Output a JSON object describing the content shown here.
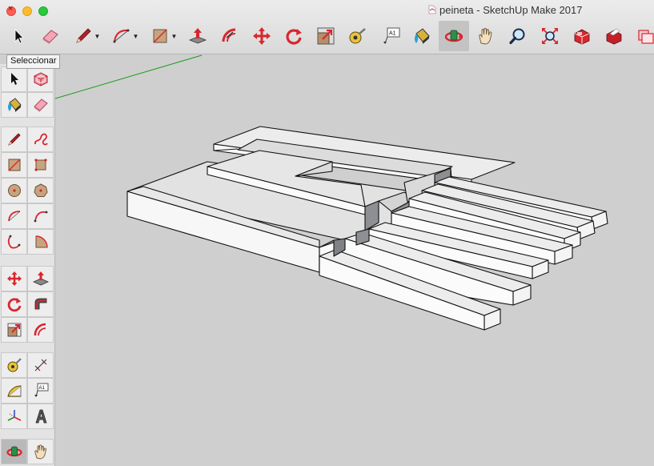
{
  "window": {
    "title": "peineta - SketchUp Make 2017"
  },
  "toolbar": {
    "items": [
      {
        "name": "select-tool",
        "icon": "arrow-cursor-icon"
      },
      {
        "name": "eraser-tool",
        "icon": "eraser-icon"
      },
      {
        "name": "line-tool",
        "icon": "pencil-icon",
        "dropdown": true
      },
      {
        "name": "arc-tool",
        "icon": "arc-icon",
        "dropdown": true
      },
      {
        "name": "rectangle-tool",
        "icon": "rectangle-icon",
        "dropdown": true
      },
      {
        "name": "push-pull-tool",
        "icon": "push-pull-icon"
      },
      {
        "name": "offset-tool",
        "icon": "offset-icon"
      },
      {
        "name": "move-tool",
        "icon": "move-arrows-icon"
      },
      {
        "name": "rotate-tool",
        "icon": "rotate-icon"
      },
      {
        "name": "scale-tool",
        "icon": "scale-icon"
      },
      {
        "name": "tape-measure-tool",
        "icon": "tape-measure-icon"
      },
      {
        "name": "text-tool",
        "icon": "text-label-icon"
      },
      {
        "name": "paint-bucket-tool",
        "icon": "paint-bucket-icon"
      },
      {
        "name": "orbit-tool",
        "icon": "orbit-icon",
        "active": true
      },
      {
        "name": "pan-tool",
        "icon": "hand-icon"
      },
      {
        "name": "zoom-tool",
        "icon": "magnifier-icon"
      },
      {
        "name": "zoom-extents-tool",
        "icon": "zoom-extents-icon"
      },
      {
        "name": "warehouse-tool",
        "icon": "3d-warehouse-icon"
      },
      {
        "name": "share-model-tool",
        "icon": "share-model-icon"
      },
      {
        "name": "extension-warehouse-tool",
        "icon": "extension-warehouse-icon"
      }
    ]
  },
  "tooltip": {
    "text": "Seleccionar"
  },
  "palette": {
    "items": [
      {
        "name": "select",
        "icon": "arrow-cursor-icon"
      },
      {
        "name": "make-component",
        "icon": "component-icon"
      },
      {
        "name": "paint-bucket",
        "icon": "paint-bucket-icon"
      },
      {
        "name": "eraser",
        "icon": "eraser-icon"
      },
      {
        "name": "line",
        "icon": "pencil-icon"
      },
      {
        "name": "freehand",
        "icon": "freehand-icon"
      },
      {
        "name": "rectangle",
        "icon": "rectangle-icon"
      },
      {
        "name": "rotated-rectangle",
        "icon": "rotated-rectangle-icon"
      },
      {
        "name": "circle",
        "icon": "circle-icon"
      },
      {
        "name": "polygon",
        "icon": "polygon-icon"
      },
      {
        "name": "arc",
        "icon": "arc-icon"
      },
      {
        "name": "two-point-arc",
        "icon": "two-point-arc-icon"
      },
      {
        "name": "three-point-arc",
        "icon": "three-point-arc-icon"
      },
      {
        "name": "pie",
        "icon": "pie-icon"
      },
      {
        "name": "move",
        "icon": "move-arrows-icon"
      },
      {
        "name": "push-pull",
        "icon": "push-pull-icon"
      },
      {
        "name": "rotate",
        "icon": "rotate-icon"
      },
      {
        "name": "follow-me",
        "icon": "follow-me-icon"
      },
      {
        "name": "scale",
        "icon": "scale-icon"
      },
      {
        "name": "offset",
        "icon": "offset-icon"
      },
      {
        "name": "tape-measure",
        "icon": "tape-measure-icon"
      },
      {
        "name": "dimension",
        "icon": "dimension-icon"
      },
      {
        "name": "protractor",
        "icon": "protractor-icon"
      },
      {
        "name": "text",
        "icon": "text-label-icon"
      },
      {
        "name": "axes",
        "icon": "axes-icon"
      },
      {
        "name": "3d-text",
        "icon": "3d-text-icon"
      },
      {
        "name": "orbit",
        "icon": "orbit-icon",
        "active": true
      },
      {
        "name": "pan",
        "icon": "hand-icon"
      }
    ]
  },
  "colors": {
    "viewport_bg": "#cfcfcf",
    "face_light": "#ffffff",
    "face_top": "#e4e4e4",
    "face_shadow": "#8d8f93",
    "axis_green": "#1a9a1a",
    "tool_red": "#d8262e"
  }
}
